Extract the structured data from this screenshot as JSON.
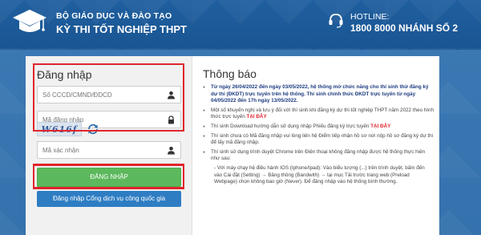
{
  "header": {
    "ministry": "BỘ GIÁO DỤC VÀ ĐÀO TẠO",
    "title": "KỲ THI TỐT NGHIỆP THPT",
    "hotline_label": "HOTLINE:",
    "hotline_number": "1800 8000 NHÁNH SỐ 2"
  },
  "login": {
    "title": "Đăng nhập",
    "id_placeholder": "Số CCCD/CMND/ĐDCD",
    "password_placeholder": "Mã đăng nhập",
    "captcha_text": "W616f",
    "captcha_placeholder": "Mã xác nhận",
    "login_button": "ĐĂNG NHẬP",
    "gov_button": "Đăng nhập Cổng dịch vụ công quốc gia"
  },
  "notice": {
    "title": "Thông báo",
    "items": [
      {
        "text": "Từ ngày 26/04/2022 đến ngày 03/05/2022, hệ thống mở chức năng cho thí sinh thử đăng ký dự thi (ĐKDT) trực tuyến trên hệ thống. Thí sinh chính thức ĐKDT trực tuyến từ ngày 04/05/2022 đến 17h ngày 13/05/2022."
      },
      {
        "text": "Một số khuyến nghị và lưu ý đối với thí sinh khi đăng ký dự thi tốt nghiệp THPT năm 2022 theo hình thức trực tuyến",
        "link": "TẠI ĐÂY"
      },
      {
        "text": "Thí sinh Download hướng dẫn sử dụng nhập Phiếu đăng ký trực tuyến",
        "link": "TẠI ĐÂY"
      },
      {
        "text": "Thí sinh chưa có Mã đăng nhập vui lòng liên hệ Điểm tiếp nhận hồ sơ nơi nộp hồ sơ đăng ký dự thi để lấy mã đăng nhập."
      },
      {
        "text": "Thí sinh sử dụng trình duyệt Chrome trên Điện thoại không đăng nhập được hệ thống thực hiện như sau:"
      },
      {
        "text": "- Với máy chạy hệ điều hành IOS (Iphone/Ipad): Vào biểu tượng (...) trên trình duyệt, bấm đến vào Cài đặt (Setting) → Băng thông (Bandwith) → tại mục Tải trước trang web (Preload Webpage) chọn không bao giờ (Never). Để đăng nhập vào hệ thống bình thường."
      }
    ]
  },
  "colors": {
    "header_bg": "#1f5f9f",
    "highlight_border": "#e0252c",
    "login_button": "#5cb85c",
    "gov_button": "#2e7dc3"
  },
  "icons": {
    "logo": "graduation-cap-icon",
    "hotline": "headset-icon",
    "user": "user-icon",
    "lock": "lock-icon",
    "refresh": "refresh-icon"
  }
}
